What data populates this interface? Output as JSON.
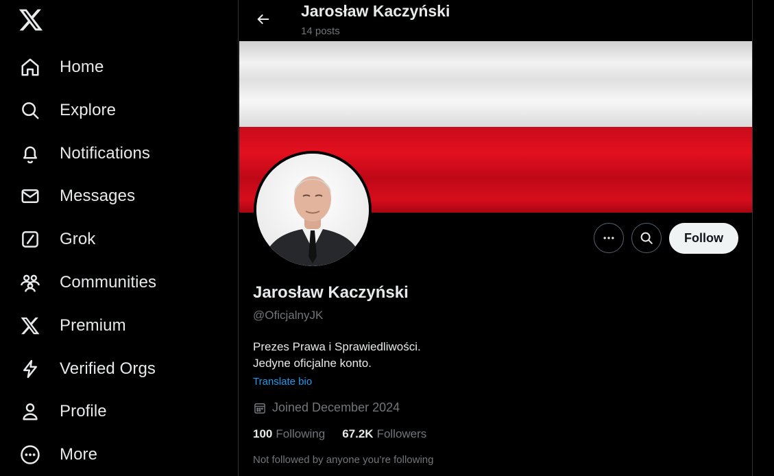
{
  "nav": {
    "logo": "x-logo",
    "items": [
      {
        "label": "Home",
        "icon": "home-icon"
      },
      {
        "label": "Explore",
        "icon": "search-icon"
      },
      {
        "label": "Notifications",
        "icon": "bell-icon"
      },
      {
        "label": "Messages",
        "icon": "envelope-icon"
      },
      {
        "label": "Grok",
        "icon": "grok-icon"
      },
      {
        "label": "Communities",
        "icon": "people-icon"
      },
      {
        "label": "Premium",
        "icon": "x-icon"
      },
      {
        "label": "Verified Orgs",
        "icon": "lightning-icon"
      },
      {
        "label": "Profile",
        "icon": "person-icon"
      },
      {
        "label": "More",
        "icon": "more-circle-icon"
      }
    ]
  },
  "header": {
    "name": "Jarosław Kaczyński",
    "posts": "14 posts"
  },
  "banner": {
    "colors": {
      "white": "#f2f2f2",
      "red": "#e3101f"
    }
  },
  "actions": {
    "follow_label": "Follow"
  },
  "profile": {
    "name": "Jarosław Kaczyński",
    "handle": "@OficjalnyJK",
    "bio_line1": "Prezes Prawa i Sprawiedliwości.",
    "bio_line2": "Jedyne oficjalne konto.",
    "translate": "Translate bio",
    "joined": "Joined December 2024",
    "following_count": "100",
    "following_label": "Following",
    "followers_count": "67.2K",
    "followers_label": "Followers",
    "not_followed": "Not followed by anyone you’re following"
  },
  "colors": {
    "background": "#000000",
    "text": "#e7e9ea",
    "muted": "#71767b",
    "link": "#1d9bf0",
    "border": "#2f3336"
  }
}
